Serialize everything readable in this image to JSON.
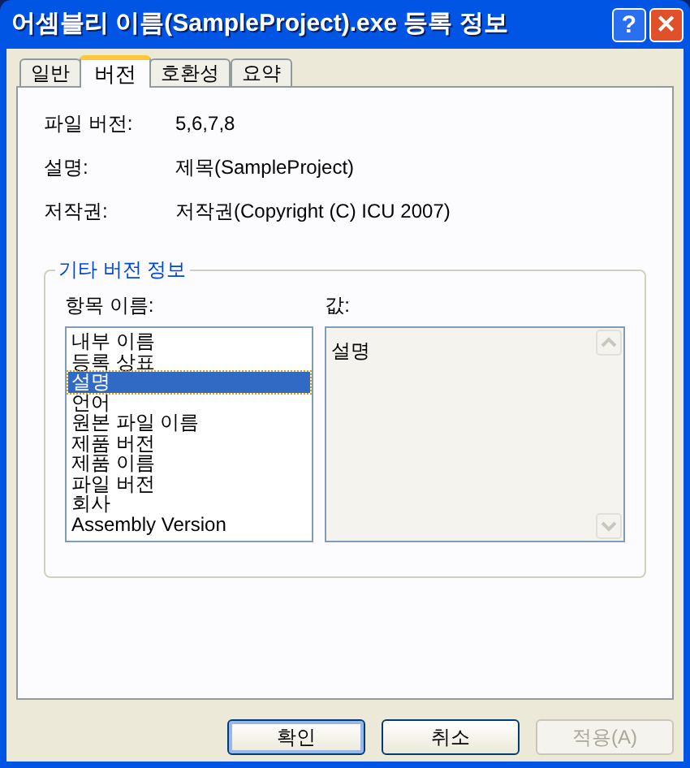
{
  "window": {
    "title": "어셈블리 이름(SampleProject).exe 등록 정보"
  },
  "title_buttons": [
    {
      "kind": "help",
      "label": "?"
    },
    {
      "kind": "close",
      "label": "✕"
    }
  ],
  "tabs": [
    {
      "label": "일반",
      "selected": false
    },
    {
      "label": "버전",
      "selected": true
    },
    {
      "label": "호환성",
      "selected": false
    },
    {
      "label": "요약",
      "selected": false
    }
  ],
  "fields": [
    {
      "label": "파일 버전:",
      "value": "5,6,7,8"
    },
    {
      "label": "설명:",
      "value": "제목(SampleProject)"
    },
    {
      "label": "저작권:",
      "value": "저작권(Copyright (C) ICU 2007)"
    }
  ],
  "group": {
    "title": "기타 버전 정보",
    "items_label": "항목 이름:",
    "value_label": "값:",
    "items": [
      {
        "label": "내부 이름",
        "selected": false
      },
      {
        "label": "등록 상표",
        "selected": false
      },
      {
        "label": "설명",
        "selected": true
      },
      {
        "label": "언어",
        "selected": false
      },
      {
        "label": "원본 파일 이름",
        "selected": false
      },
      {
        "label": "제품 버전",
        "selected": false
      },
      {
        "label": "제품 이름",
        "selected": false
      },
      {
        "label": "파일 버전",
        "selected": false
      },
      {
        "label": "회사",
        "selected": false
      },
      {
        "label": "Assembly Version",
        "selected": false
      }
    ],
    "value": "설명"
  },
  "buttons": [
    {
      "label": "확인",
      "disabled": false,
      "default": true
    },
    {
      "label": "취소",
      "disabled": false,
      "default": false
    },
    {
      "label": "적용(A)",
      "disabled": true,
      "default": false
    }
  ]
}
